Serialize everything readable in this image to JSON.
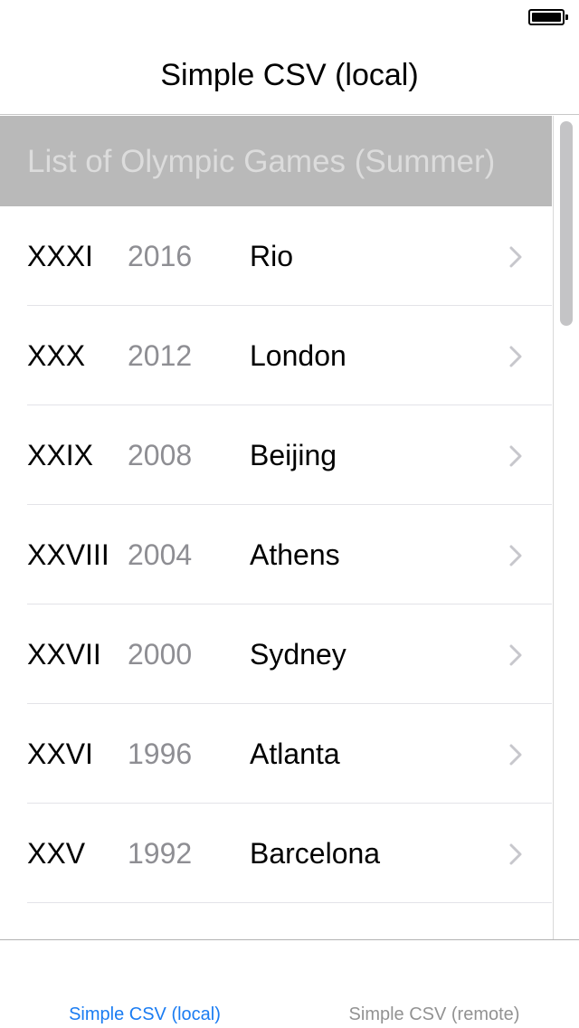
{
  "navigation": {
    "title": "Simple CSV (local)"
  },
  "section": {
    "header": "List of Olympic Games (Summer)"
  },
  "rows": [
    {
      "roman": "XXXI",
      "year": "2016",
      "city": "Rio"
    },
    {
      "roman": "XXX",
      "year": "2012",
      "city": "London"
    },
    {
      "roman": "XXIX",
      "year": "2008",
      "city": "Beijing"
    },
    {
      "roman": "XXVIII",
      "year": "2004",
      "city": "Athens"
    },
    {
      "roman": "XXVII",
      "year": "2000",
      "city": "Sydney"
    },
    {
      "roman": "XXVI",
      "year": "1996",
      "city": "Atlanta"
    },
    {
      "roman": "XXV",
      "year": "1992",
      "city": "Barcelona"
    },
    {
      "roman": "",
      "year": "",
      "city": ""
    }
  ],
  "tab_bar": {
    "tabs": [
      {
        "label": "Simple CSV (local)",
        "selected": true
      },
      {
        "label": "Simple CSV (remote)",
        "selected": false
      }
    ]
  },
  "colors": {
    "accent": "#1a7cf2",
    "tab_inactive": "#929292",
    "section_header_bg": "#b9b9b9",
    "section_header_text": "#dcdcdc",
    "year_text": "#8e8e93",
    "chevron": "#c7c7cc"
  },
  "icons": {
    "battery": "battery-full-icon",
    "disclosure": "chevron-right-icon"
  },
  "status": {
    "battery_level": 1.0
  }
}
